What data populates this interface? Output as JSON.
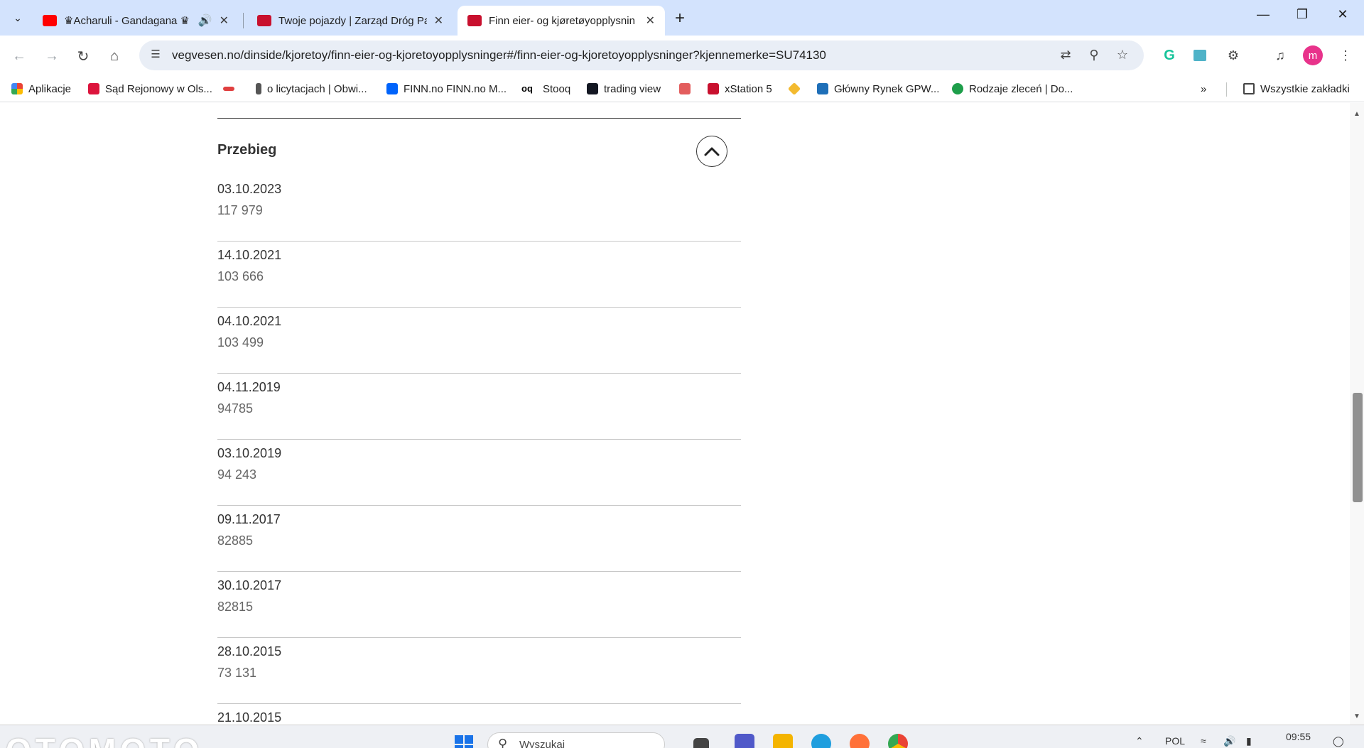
{
  "browser": {
    "tabs": [
      {
        "title": "♛Acharuli - Gandagana ♛",
        "favicon_color": "#ff0000"
      },
      {
        "title": "Twoje pojazdy | Zarząd Dróg Pa",
        "favicon_color": "#c8102e"
      },
      {
        "title": "Finn eier- og kjøretøyopplysnin",
        "favicon_color": "#c8102e"
      }
    ],
    "url": "vegvesen.no/dinside/kjoretoy/finn-eier-og-kjoretoyopplysninger#/finn-eier-og-kjoretoyopplysninger?kjennemerke=SU74130",
    "avatar_letter": "m",
    "bookmarks": [
      {
        "label": "Aplikacje",
        "icon": "apps-grid-icon"
      },
      {
        "label": "Sąd Rejonowy w Ols...",
        "icon": "eagle-icon"
      },
      {
        "label": "",
        "icon": "car-icon"
      },
      {
        "label": "o licytacjach | Obwi...",
        "icon": "hammer-icon"
      },
      {
        "label": "FINN.no FINN.no M...",
        "icon": "finn-icon"
      },
      {
        "label": "Stooq",
        "icon": "stooq-icon"
      },
      {
        "label": "trading view",
        "icon": "tradingview-icon"
      },
      {
        "label": "",
        "icon": "crest-icon"
      },
      {
        "label": "xStation 5",
        "icon": "xtb-icon"
      },
      {
        "label": "",
        "icon": "binance-icon"
      },
      {
        "label": "Główny Rynek GPW...",
        "icon": "gpw-icon"
      },
      {
        "label": "Rodzaje zleceń | Do...",
        "icon": "leaf-icon"
      }
    ],
    "bookmarks_more": "»",
    "all_bookmarks": "Wszystkie zakładki"
  },
  "mileage": {
    "title": "Przebieg",
    "records": [
      {
        "date": "03.10.2023",
        "km": "117 979"
      },
      {
        "date": "14.10.2021",
        "km": "103 666"
      },
      {
        "date": "04.10.2021",
        "km": "103 499"
      },
      {
        "date": "04.11.2019",
        "km": "94785"
      },
      {
        "date": "03.10.2019",
        "km": "94 243"
      },
      {
        "date": "09.11.2017",
        "km": "82885"
      },
      {
        "date": "30.10.2017",
        "km": "82815"
      },
      {
        "date": "28.10.2015",
        "km": "73 131"
      },
      {
        "date": "21.10.2015",
        "km": ""
      }
    ]
  },
  "taskbar": {
    "watermark": "OTOMOTO",
    "search_placeholder": "Wyszukaj",
    "language": "POL",
    "time": "09:55"
  }
}
